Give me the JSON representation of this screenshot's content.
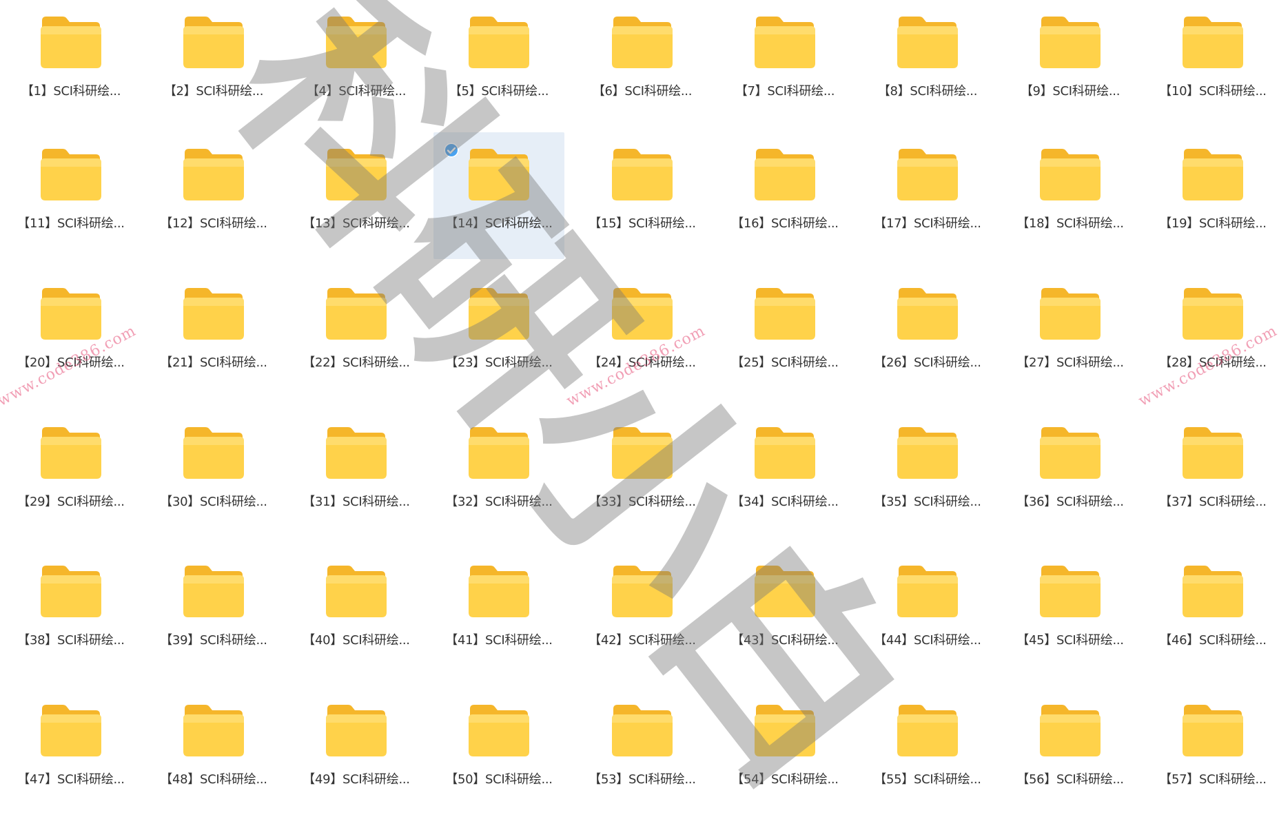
{
  "folders": [
    "【1】SCI科研绘...",
    "【2】SCI科研绘...",
    "【4】SCI科研绘...",
    "【5】SCI科研绘...",
    "【6】SCI科研绘...",
    "【7】SCI科研绘...",
    "【8】SCI科研绘...",
    "【9】SCI科研绘...",
    "【10】SCI科研绘...",
    "【11】SCI科研绘...",
    "【12】SCI科研绘...",
    "【13】SCI科研绘...",
    "【14】SCI科研绘...",
    "【15】SCI科研绘...",
    "【16】SCI科研绘...",
    "【17】SCI科研绘...",
    "【18】SCI科研绘...",
    "【19】SCI科研绘...",
    "【20】SCI科研绘...",
    "【21】SCI科研绘...",
    "【22】SCI科研绘...",
    "【23】SCI科研绘...",
    "【24】SCI科研绘...",
    "【25】SCI科研绘...",
    "【26】SCI科研绘...",
    "【27】SCI科研绘...",
    "【28】SCI科研绘...",
    "【29】SCI科研绘...",
    "【30】SCI科研绘...",
    "【31】SCI科研绘...",
    "【32】SCI科研绘...",
    "【33】SCI科研绘...",
    "【34】SCI科研绘...",
    "【35】SCI科研绘...",
    "【36】SCI科研绘...",
    "【37】SCI科研绘...",
    "【38】SCI科研绘...",
    "【39】SCI科研绘...",
    "【40】SCI科研绘...",
    "【41】SCI科研绘...",
    "【42】SCI科研绘...",
    "【43】SCI科研绘...",
    "【44】SCI科研绘...",
    "【45】SCI科研绘...",
    "【46】SCI科研绘...",
    "【47】SCI科研绘...",
    "【48】SCI科研绘...",
    "【49】SCI科研绘...",
    "【50】SCI科研绘...",
    "【53】SCI科研绘...",
    "【54】SCI科研绘...",
    "【55】SCI科研绘...",
    "【56】SCI科研绘...",
    "【57】SCI科研绘..."
  ],
  "selected_index": 12,
  "icon": "folder-icon",
  "selection_icon": "check-circle-icon",
  "colors": {
    "folder_body": "#FFD24A",
    "folder_back": "#F5B62A",
    "selection_bg": "#E6EEF7",
    "check": "#4AA3F0",
    "label": "#333333"
  },
  "watermark": {
    "text": "科研小白",
    "url": "www.code386.com"
  }
}
